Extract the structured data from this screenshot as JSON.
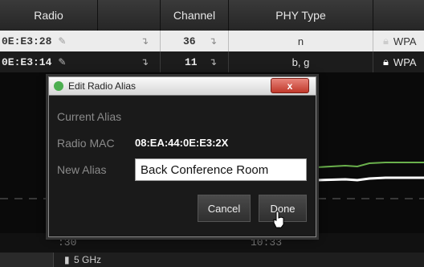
{
  "table": {
    "headers": {
      "radio": "Radio",
      "channel": "Channel",
      "phy": "PHY Type"
    },
    "rows": [
      {
        "radio": "0E:E3:28",
        "channel": "36",
        "phy": "n",
        "security": "WPA"
      },
      {
        "radio": "0E:E3:14",
        "channel": "11",
        "phy": "b, g",
        "security": "WPA"
      }
    ]
  },
  "chart": {
    "lines": [
      {
        "name": "green",
        "color": "#6ab04c"
      },
      {
        "name": "white",
        "color": "#ffffff"
      }
    ],
    "axis_labels": [
      ":30",
      "10:33"
    ]
  },
  "bottom_bar": {
    "band": "5 GHz"
  },
  "dialog": {
    "title": "Edit Radio Alias",
    "close_label": "x",
    "current_alias_label": "Current Alias",
    "current_alias_value": "",
    "radio_mac_label": "Radio MAC",
    "radio_mac_value": "08:EA:44:0E:E3:2X",
    "new_alias_label": "New Alias",
    "new_alias_value": "Back Conference Room",
    "cancel_label": "Cancel",
    "done_label": "Done"
  }
}
